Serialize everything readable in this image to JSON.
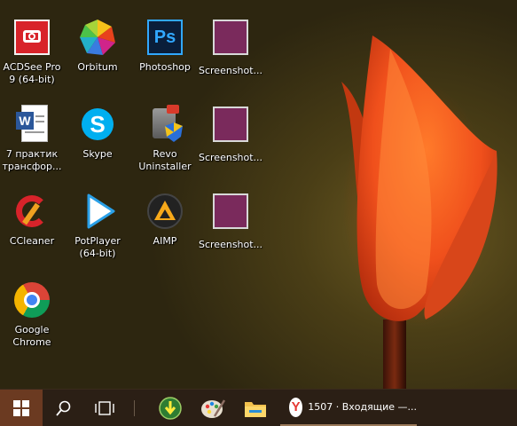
{
  "desktop": {
    "icons": [
      {
        "label": "ACDSee Pro\n9 (64-bit)",
        "icon": "acdsee-icon"
      },
      {
        "label": "Orbitum",
        "icon": "orbitum-icon"
      },
      {
        "label": "Photoshop",
        "icon": "photoshop-icon"
      },
      {
        "label": "Screenshot...",
        "icon": "screenshot-thumbnail-icon"
      },
      {
        "label": "7 практик\nтрансфор...",
        "icon": "word-document-icon"
      },
      {
        "label": "Skype",
        "icon": "skype-icon"
      },
      {
        "label": "Revo\nUninstaller",
        "icon": "revo-uninstaller-icon"
      },
      {
        "label": "Screenshot...",
        "icon": "screenshot-thumbnail-icon"
      },
      {
        "label": "CCleaner",
        "icon": "ccleaner-icon"
      },
      {
        "label": "PotPlayer\n(64-bit)",
        "icon": "potplayer-icon"
      },
      {
        "label": "AIMP",
        "icon": "aimp-icon"
      },
      {
        "label": "Screenshot...",
        "icon": "screenshot-thumbnail-icon"
      },
      {
        "label": "Google\nChrome",
        "icon": "chrome-icon"
      }
    ],
    "photoshop_glyph": "Ps"
  },
  "taskbar": {
    "start_icon": "windows-start-icon",
    "search_icon": "search-icon",
    "task_view_icon": "task-view-icon",
    "pinned": [
      "download-master-icon",
      "paint-icon",
      "file-explorer-icon"
    ],
    "active_app": {
      "icon": "yandex-browser-icon",
      "title": "1507 · Входящие —...",
      "glyph": "Y"
    }
  },
  "colors": {
    "taskbar": "#2b1f15",
    "start_highlight": "#6b3a21",
    "accent_orange": "#e8501a"
  }
}
